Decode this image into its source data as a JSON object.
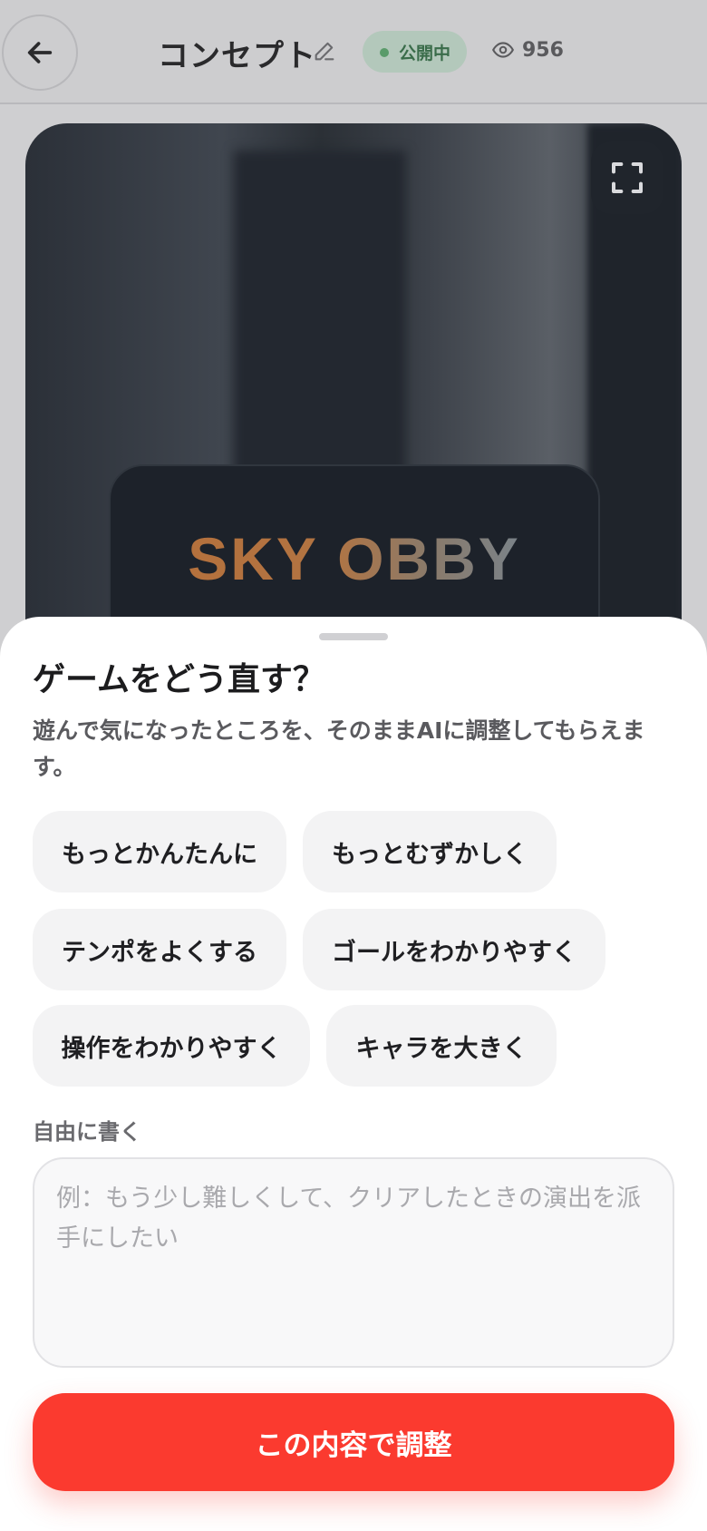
{
  "header": {
    "title": "コンセプト",
    "status": "公開中",
    "views": "956"
  },
  "preview": {
    "game_title": "SKY OBBY"
  },
  "sheet": {
    "title": "ゲームをどう直す？",
    "description": "遊んで気になったところを、そのままAIに調整してもらえます。",
    "suggestions": [
      "もっとかんたんに",
      "もっとむずかしく",
      "テンポをよくする",
      "ゴールをわかりやすく",
      "操作をわかりやすく",
      "キャラを大きく"
    ],
    "free_label": "自由に書く",
    "free_placeholder": "例：もう少し難しくして、クリアしたときの演出を派手にしたい",
    "submit_label": "この内容で調整"
  },
  "colors": {
    "accent": "#fb3a2f",
    "status_green": "#3a6c4a"
  },
  "icons": [
    "back-arrow-icon",
    "pencil-icon",
    "status-dot-icon",
    "eye-icon",
    "fullscreen-icon"
  ]
}
